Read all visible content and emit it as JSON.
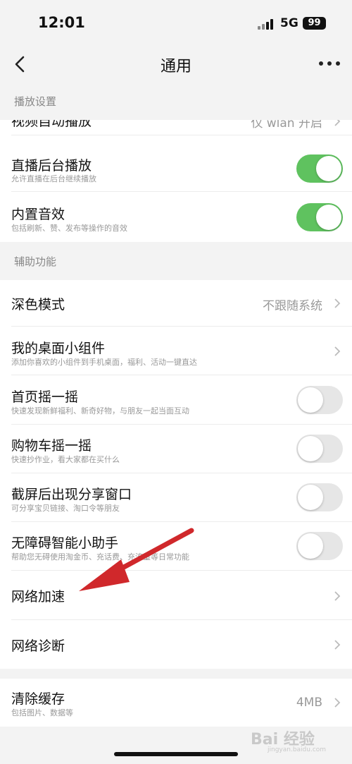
{
  "status_bar": {
    "time": "12:01",
    "network": "5G",
    "battery": "99"
  },
  "nav": {
    "title": "通用"
  },
  "sections": {
    "playback": "播放设置",
    "assist": "辅助功能"
  },
  "rows": {
    "autoplay": {
      "title": "视频自动播放",
      "value": "仅 wlan 开启"
    },
    "live_bg": {
      "title": "直播后台播放",
      "sub": "允许直播在后台继续播放",
      "toggle": "on"
    },
    "sound": {
      "title": "内置音效",
      "sub": "包括刷新、赞、发布等操作的音效",
      "toggle": "on"
    },
    "dark": {
      "title": "深色模式",
      "value": "不跟随系统"
    },
    "widget": {
      "title": "我的桌面小组件",
      "sub": "添加你喜欢的小组件到手机桌面，福利、活动一键直达"
    },
    "shake_home": {
      "title": "首页摇一摇",
      "sub": "快速发现新鲜福利、新奇好物，与朋友一起当面互动",
      "toggle": "off"
    },
    "shake_cart": {
      "title": "购物车摇一摇",
      "sub": "快速抄作业，看大家都在买什么",
      "toggle": "off"
    },
    "screenshot_share": {
      "title": "截屏后出现分享窗口",
      "sub": "可分享宝贝链接、淘口令等朋友",
      "toggle": "off"
    },
    "accessibility": {
      "title": "无障碍智能小助手",
      "sub": "帮助您无碍使用淘金币、充话费、充流量等日常功能",
      "toggle": "off"
    },
    "net_speed": {
      "title": "网络加速"
    },
    "net_diag": {
      "title": "网络诊断"
    },
    "cache": {
      "title": "清除缓存",
      "sub": "包括图片、数据等",
      "value": "4MB"
    }
  },
  "watermark": {
    "text": "Bai 经验",
    "sub": "jingyan.baidu.com"
  },
  "colors": {
    "toggle_on": "#5fc25f",
    "arrow": "#d0282b"
  }
}
